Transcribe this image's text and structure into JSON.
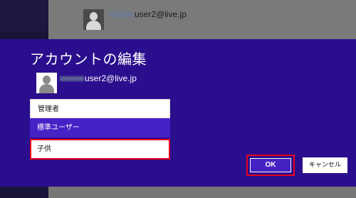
{
  "background": {
    "account_email": "user2@live.jp",
    "colors": {
      "dim_content": "#7a7a7a",
      "sidebar": "#18143a"
    }
  },
  "dialog": {
    "title": "アカウントの編集",
    "user_email": "user2@live.jp",
    "account_types": [
      {
        "label": "管理者",
        "state": "normal"
      },
      {
        "label": "標準ユーザー",
        "state": "selected"
      },
      {
        "label": "子供",
        "state": "highlighted"
      }
    ],
    "ok_label": "OK",
    "cancel_label": "キャンセル",
    "colors": {
      "band": "#2a0e8e",
      "accent": "#4621c6",
      "highlight": "#e8001a"
    }
  }
}
